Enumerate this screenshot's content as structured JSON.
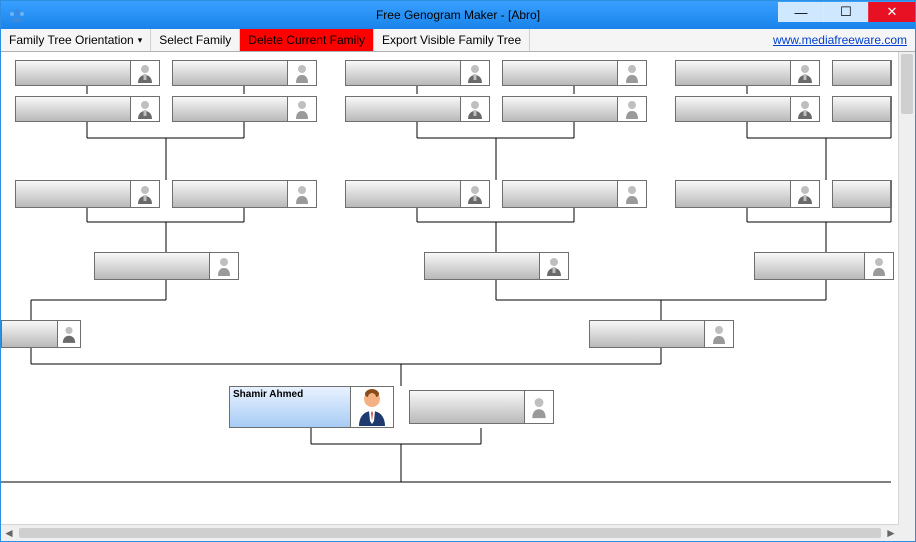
{
  "window": {
    "title": "Free Genogram Maker - [Abro]"
  },
  "toolbar": {
    "orientation": "Family Tree Orientation",
    "select": "Select Family",
    "delete": "Delete Current Family",
    "export": "Export Visible Family Tree",
    "link_text": "www.mediafreeware.com",
    "link_href": "http://www.mediafreeware.com"
  },
  "nodes": {
    "home_name": "Shamir Ahmed"
  },
  "icons": {
    "male": "male-icon",
    "female": "female-icon",
    "male_color": "male-color-icon"
  }
}
